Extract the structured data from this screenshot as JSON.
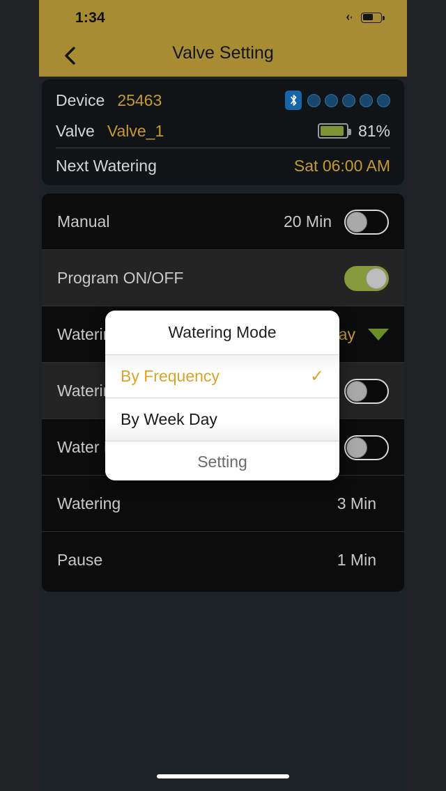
{
  "status_bar": {
    "time": "1:34",
    "airplane_icon": "airplane-icon",
    "battery_icon": "battery-icon"
  },
  "nav": {
    "back_icon": "chevron-left-icon",
    "title": "Valve Setting"
  },
  "device_card": {
    "device_label": "Device",
    "device_value": "25463",
    "valve_label": "Valve",
    "valve_value": "Valve_1",
    "bluetooth_icon": "bluetooth-icon",
    "signal_dots": 5,
    "battery_icon": "battery-icon",
    "battery_percent": "81%",
    "next_watering_label": "Next Watering",
    "next_watering_value": "Sat 06:00 AM"
  },
  "settings": {
    "rows": [
      {
        "label": "Manual",
        "value": "20 Min",
        "control": "toggle-off"
      },
      {
        "label": "Program ON/OFF",
        "value": "",
        "control": "toggle-on"
      },
      {
        "label": "Watering Mode",
        "value": "By Week Day",
        "control": "caret-down"
      },
      {
        "label": "Watering Days",
        "value": "",
        "control": "toggle-off"
      },
      {
        "label": "Water Now",
        "value": "",
        "control": "toggle-off"
      },
      {
        "label": "Watering",
        "value": "3 Min",
        "control": "none"
      },
      {
        "label": "Pause",
        "value": "1 Min",
        "control": "none"
      }
    ]
  },
  "modal": {
    "title": "Watering Mode",
    "options": [
      {
        "label": "By Frequency",
        "selected": true,
        "check": "✓"
      },
      {
        "label": "By Week Day",
        "selected": false,
        "check": ""
      }
    ],
    "footer_label": "Setting"
  },
  "colors": {
    "header_gold": "#a88c34",
    "accent_gold": "#c39a34",
    "toggle_on_green": "#87993c",
    "caret_green": "#6f8c2a",
    "battery_green": "#7f9434",
    "bluetooth_blue": "#1565a8",
    "modal_selected": "#d9a42b"
  }
}
